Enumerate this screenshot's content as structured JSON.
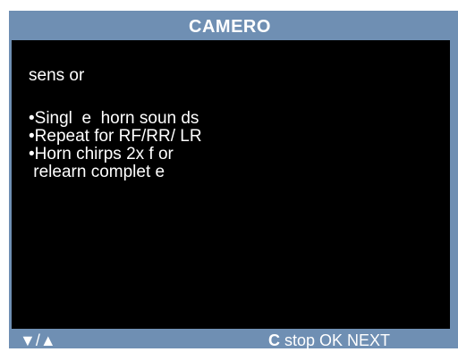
{
  "title": "CAMERO",
  "screen": {
    "heading": "sens or",
    "bullets": [
      "•Singl  e  horn soun ds",
      "•Repeat for RF/RR/ LR",
      "•Horn chirps 2x f or",
      " relearn complet e"
    ]
  },
  "footer": {
    "down_arrow": "▼",
    "separator": " / ",
    "up_arrow": "▲",
    "c_key": "C",
    "stop_label": " stop ",
    "ok_label": "OK ",
    "next_label": "NEXT"
  },
  "colors": {
    "frame": "#6f8fb3",
    "screen_background": "#000000",
    "text": "#ffffff"
  }
}
